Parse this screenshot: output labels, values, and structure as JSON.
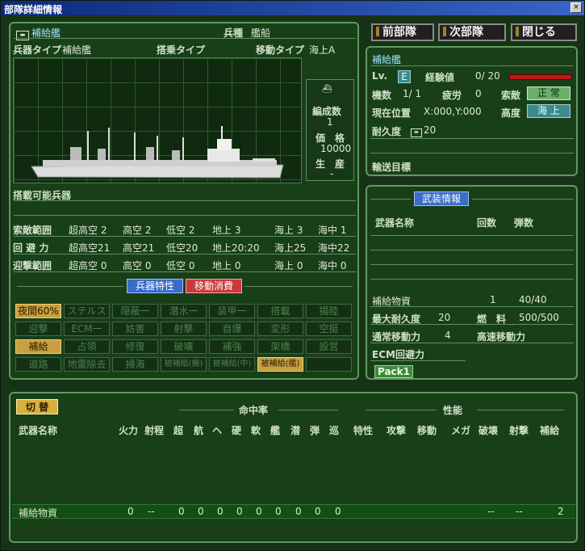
{
  "window": {
    "title": "部隊詳細情報"
  },
  "nav": {
    "prev": "前部隊",
    "next": "次部隊",
    "close": "閉じる"
  },
  "unit": {
    "name": "補給艦",
    "branch_label": "兵種",
    "branch_value": "艦船",
    "weapon_type_label": "兵器タイプ",
    "weapon_type_value": "補給艦",
    "carrier_type_label": "搭乗タイプ",
    "move_type_label": "移動タイプ",
    "move_type_value": "海上A",
    "formation_label": "編成数",
    "formation_value": "1",
    "price_label": "価　格",
    "price_value": "10000",
    "production_label": "生　産",
    "production_value": "-",
    "loadable_label": "搭載可能兵器"
  },
  "ranges": {
    "rows": [
      {
        "label": "索敵範囲",
        "values": [
          "超高空 2",
          "高空 2",
          "低空 2",
          "地上 3",
          "海上 3",
          "海中 1"
        ]
      },
      {
        "label": "回 避 力",
        "values": [
          "超高空21",
          "高空21",
          "低空20",
          "地上20:20",
          "海上25",
          "海中22"
        ]
      },
      {
        "label": "迎撃範囲",
        "values": [
          "超高空 0",
          "高空 0",
          "低空 0",
          "地上 0",
          "海上 0",
          "海中 0"
        ]
      }
    ]
  },
  "tabs": {
    "traits": "兵器特性",
    "movecost": "移動消費"
  },
  "traits": [
    [
      "夜間60%",
      "ステルス一",
      "隠蔽一",
      "潜水一",
      "装甲一",
      "搭載",
      "揚陸"
    ],
    [
      "迎撃",
      "ECM一",
      "妨害",
      "射撃",
      "自爆",
      "変形",
      "空挺"
    ],
    [
      "補給",
      "占領",
      "修復",
      "破壊",
      "補強",
      "架橋",
      "設営"
    ],
    [
      "道路",
      "地雷除去",
      "掃海",
      "被補給(機)",
      "被補給(中)",
      "被補給(艦)",
      ""
    ]
  ],
  "traits_on": [
    "夜間60%",
    "補給",
    "被補給(艦)"
  ],
  "status": {
    "name": "補給艦",
    "lv_label": "Lv.",
    "lv_value": "E",
    "exp_label": "経験値",
    "exp_value": "0/ 20",
    "count_label": "機数",
    "count_value": "1/ 1",
    "fatigue_label": "疲労",
    "fatigue_value": "0",
    "search_label": "索敵",
    "search_value": "正 常",
    "pos_label": "現在位置",
    "pos_value": "X:000,Y:000",
    "alt_label": "高度",
    "alt_value": "海 上",
    "dur_label": "耐久度",
    "dur_value": "20",
    "transport_label": "輸送目標"
  },
  "weapons": {
    "header_btn": "武装情報",
    "col_name": "武器名称",
    "col_count": "回数",
    "col_ammo": "弾数",
    "item_name": "補給物資",
    "item_count": "1",
    "item_ammo": "40/40",
    "maxdur_label": "最大耐久度",
    "maxdur_value": "20",
    "fuel_label": "燃　料",
    "fuel_value": "500/500",
    "normal_move_label": "通常移動力",
    "normal_move_value": "4",
    "fast_move_label": "高速移動力",
    "ecm_label": "ECM回避力",
    "pack_label": "Pack1"
  },
  "bottom": {
    "toggle": "切 替",
    "hit_header": "命中率",
    "perf_header": "性能",
    "cols": [
      "武器名称",
      "火力",
      "射程",
      "超",
      "航",
      "ヘ",
      "硬",
      "軟",
      "艦",
      "潜",
      "弾",
      "巡",
      "特性",
      "攻撃",
      "移動",
      "メガ",
      "破壊",
      "射撃",
      "補給"
    ],
    "row": [
      "補給物資",
      "0",
      "--",
      "0",
      "0",
      "0",
      "0",
      "0",
      "0",
      "0",
      "0",
      "0",
      "--",
      "--",
      "2"
    ]
  }
}
